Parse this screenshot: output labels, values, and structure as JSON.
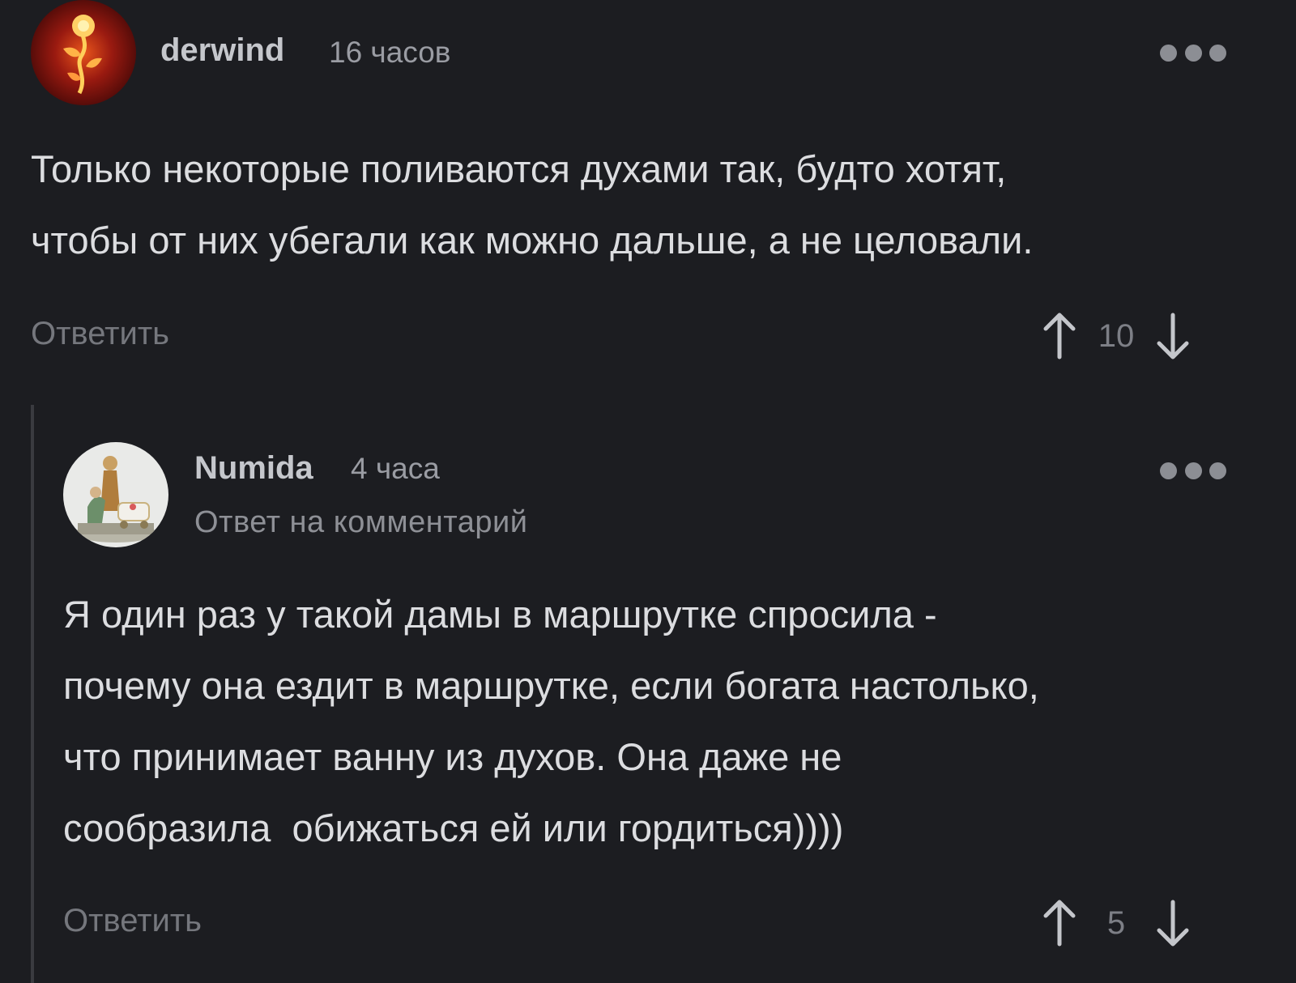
{
  "comments": [
    {
      "username": "derwind",
      "time": "16 часов",
      "avatar_icon": "fire-flower-avatar",
      "text": "Только некоторые поливаются духами так, будто хотят,\nчтобы от них убегали как можно дальше, а не целовали.",
      "reply_label": "Ответить",
      "rating": "10",
      "more_icon": "ellipsis-icon"
    },
    {
      "username": "Numida",
      "time": "4 часа",
      "reply_to": "Ответ на комментарий",
      "avatar_icon": "figurine-avatar",
      "text": "Я один раз у такой дамы в маршрутке спросила -\nпочему она ездит в маршрутке, если богата настолько,\nчто принимает ванну из духов. Она даже не\nсообразила  обижаться ей или гордиться))))",
      "reply_label": "Ответить",
      "rating": "5",
      "more_icon": "ellipsis-icon"
    }
  ],
  "colors": {
    "background": "#1c1d21",
    "text": "#dcdde0",
    "muted": "#75777d",
    "thread_line": "#3a3b40"
  }
}
